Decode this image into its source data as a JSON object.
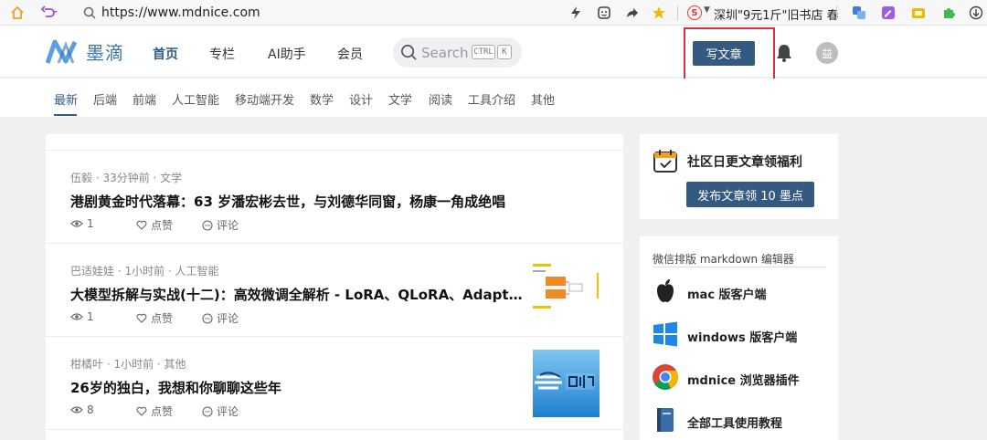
{
  "browser": {
    "url": "https://www.mdnice.com",
    "hot_search": "深圳\"9元1斤\"旧书店 春"
  },
  "header": {
    "logo_text": "墨滴",
    "nav": [
      "首页",
      "专栏",
      "AI助手",
      "会员"
    ],
    "search": {
      "placeholder": "Search",
      "kbd_ctrl": "CTRL",
      "kbd_k": "K"
    },
    "write_button": "写文章",
    "avatar_initial": "益"
  },
  "categories": [
    "最新",
    "后端",
    "前端",
    "人工智能",
    "移动端开发",
    "数学",
    "设计",
    "文学",
    "阅读",
    "工具介绍",
    "其他"
  ],
  "articles": [
    {
      "meta": "伍毅 · 33分钟前 · 文学",
      "title": "港剧黄金时代落幕：63 岁潘宏彬去世，与刘德华同窗，杨康一角成绝唱",
      "views": "1",
      "like_label": "点赞",
      "comment_label": "评论",
      "thumb": ""
    },
    {
      "meta": "巴适娃娃 · 1小时前 · 人工智能",
      "title": "大模型拆解与实战(十二)：高效微调全解析 - LoRA、QLoRA、Adapter对比...",
      "views": "1",
      "like_label": "点赞",
      "comment_label": "评论",
      "thumb": "diagram"
    },
    {
      "meta": "柑橘叶 · 1小时前 · 其他",
      "title": "26岁的独白，我想和你聊聊这些年",
      "views": "8",
      "like_label": "点赞",
      "comment_label": "评论",
      "thumb": "logo"
    }
  ],
  "sidebar": {
    "promo_title": "社区日更文章领福利",
    "promo_button": "发布文章领 10 墨点",
    "tools_title": "微信排版 markdown 编辑器",
    "tools": [
      {
        "label": "mac 版客户端",
        "icon": "apple-icon"
      },
      {
        "label": "windows 版客户端",
        "icon": "windows-icon"
      },
      {
        "label": "mdnice 浏览器插件",
        "icon": "chrome-icon"
      },
      {
        "label": "全部工具使用教程",
        "icon": "book-icon"
      }
    ]
  },
  "colors": {
    "brand": "#355a82",
    "active": "#2f5c8a",
    "highlight": "#d9323a"
  }
}
